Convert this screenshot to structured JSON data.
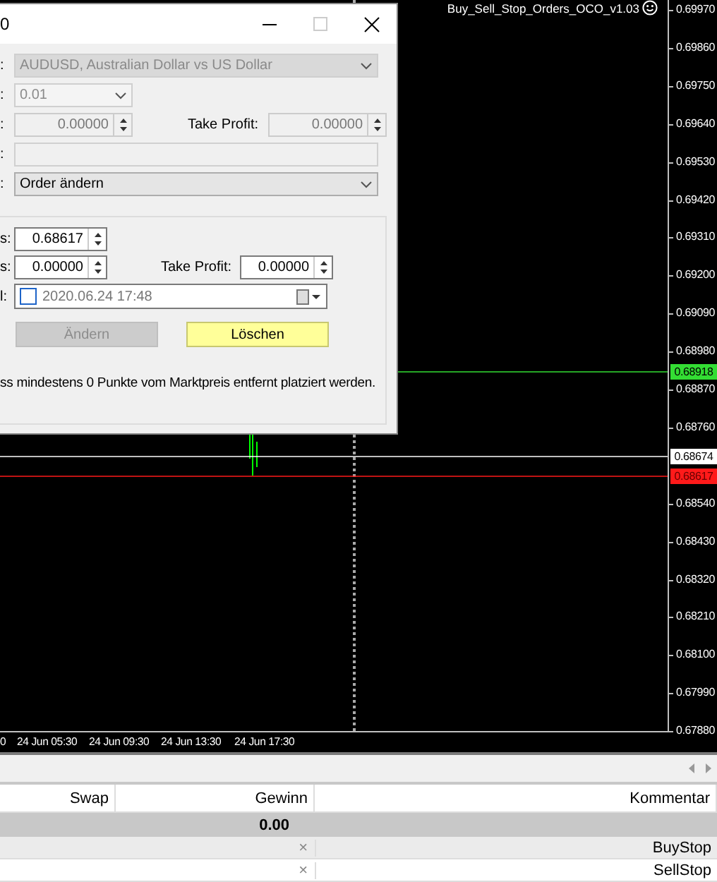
{
  "chart": {
    "indicator_label": "Buy_Sell_Stop_Orders_OCO_v1.03",
    "price_ticks": [
      "0.69970",
      "0.69860",
      "0.69750",
      "0.69640",
      "0.69530",
      "0.69420",
      "0.69310",
      "0.69200",
      "0.69090",
      "0.68980",
      "0.68870",
      "0.68760",
      "0.68540",
      "0.68430",
      "0.68320",
      "0.68210",
      "0.68100",
      "0.67990",
      "0.67880"
    ],
    "price_markers": [
      {
        "text": "0.68918",
        "color": "#33dd33"
      },
      {
        "text": "0.68674",
        "color": "#ffffff"
      },
      {
        "text": "0.68617",
        "color": "#ff1a1a"
      }
    ],
    "time_labels": [
      "0",
      "24 Jun 05:30",
      "24 Jun 09:30",
      "24 Jun 13:30",
      "24 Jun 17:30"
    ]
  },
  "dialog": {
    "title": "0",
    "symbol": {
      "label": ":",
      "value": "AUDUSD, Australian Dollar vs US Dollar",
      "disabled": true
    },
    "volume": {
      "label": ":",
      "value": "0.01",
      "disabled": true
    },
    "stops": {
      "label": ":",
      "value": "0.00000",
      "disabled": true,
      "tp_label": "Take Profit:",
      "tp_value": "0.00000"
    },
    "comment": {
      "label": ":",
      "disabled": true
    },
    "operation": {
      "label": ":",
      "value": "Order ändern",
      "disabled": false
    },
    "modify": {
      "price": {
        "label": "s:",
        "value": "0.68617"
      },
      "sl": {
        "label": "s:",
        "value": "0.00000"
      },
      "tp": {
        "label": "Take Profit:",
        "value": "0.00000"
      },
      "expiry": {
        "label": "l:",
        "checked": false,
        "value": "2020.06.24 17:48"
      }
    },
    "buttons": [
      {
        "label": "Ändern",
        "kind": "modify",
        "disabled": true
      },
      {
        "label": "Löschen",
        "kind": "delete",
        "disabled": false
      }
    ],
    "note": "ss mindestens 0 Punkte vom Marktpreis entfernt platziert werden."
  },
  "terminal": {
    "columns": [
      "Swap",
      "Gewinn",
      "Kommentar"
    ],
    "total": "0.00",
    "rows": [
      {
        "close": "×",
        "comment": "BuyStop"
      },
      {
        "close": "×",
        "comment": "SellStop"
      }
    ]
  }
}
